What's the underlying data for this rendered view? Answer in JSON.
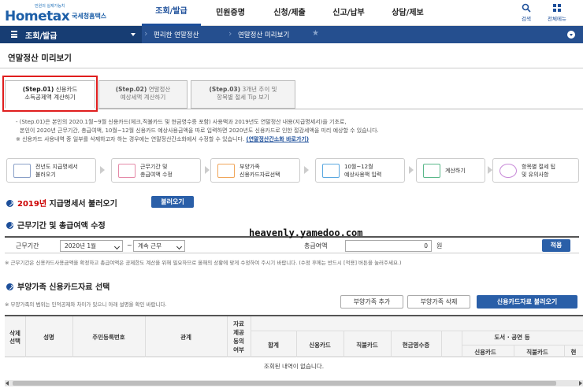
{
  "header": {
    "logo_small": "민원의 실제가능치",
    "logo_main": "Hometax",
    "logo_sub": "국세청홈택스",
    "nav": [
      "조회/발급",
      "민원증명",
      "신청/제출",
      "신고/납부",
      "상담/제보"
    ],
    "search_label": "검색",
    "allmenu_label": "전체메뉴"
  },
  "breadcrumb": {
    "menu_label": "조회/발급",
    "item1": "편리한 연말정산",
    "item2": "연말정산 미리보기"
  },
  "page_title": "연말정산 미리보기",
  "steps": [
    {
      "num": "(Step.01)",
      "line1": "신용카드",
      "line2": "소득공제액 계산하기"
    },
    {
      "num": "(Step.02)",
      "line1": "연말정산",
      "line2": "예상세액 계산하기"
    },
    {
      "num": "(Step.03)",
      "line1": "3개년 추이 및",
      "line2": "항목별 절세 Tip 보기"
    }
  ],
  "notice": {
    "line1": "- (Step.01)은 본인의 2020.1월~9월 신용카드(체크,직불카드 및 현금영수증 포함) 사용액과 2019년도 연말정산 내용(지급명세서)을 기초로,",
    "line2": "본인이 2020년 근무기간, 총급여액, 10월~12월 신용카드 예상사용금액을 따로 입력하면 2020년도 신용카드로 인한 절감세액을 미리 예상할 수 있습니다.",
    "line3": "※ 신용카드 사용내역 중 일부를 삭제하고자 하는 경우에는 연말정산간소화에서 수정할 수 있습니다.",
    "link": "(연말정산간소화 바로가기)"
  },
  "process": [
    {
      "l1": "전년도 지급명세서",
      "l2": "불러오기",
      "color": "#8aa0c8"
    },
    {
      "l1": "근무기간 및",
      "l2": "총급여액 수정",
      "color": "#e58aa8"
    },
    {
      "l1": "부양가족",
      "l2": "신용카드자료선택",
      "color": "#f0a65a"
    },
    {
      "l1": "10월~12월",
      "l2": "예상사용액 입력",
      "color": "#5aa8e0"
    },
    {
      "l1": "계산하기",
      "l2": "",
      "color": "#5ab88a"
    },
    {
      "l1": "항목별 절세 팁",
      "l2": "및 유의사항",
      "color": "#c88ad8"
    }
  ],
  "section1": {
    "year": "2019년",
    "title": "지급명세서 불러오기",
    "button": "불러오기"
  },
  "section2": {
    "title": "근무기간 및 총급여액 수정",
    "label": "근무기간",
    "start": "2020년 1월",
    "tilde": "~",
    "end": "계속 근무",
    "amount_label": "총급여액",
    "amount_value": "0",
    "won": "원",
    "apply": "적용",
    "note": "※ 근무기간은 신용카드사용금액을 확정하고 총급여액은 공제한도 계산을 위해 필요하므로 올해의 상황에 맞게 수정하여 주시기 바랍니다. (수정 후에는 반드시 [적용] 버튼을 눌러주세요.)"
  },
  "section3": {
    "title": "부양가족 신용카드자료 선택",
    "note": "※ 부양가족의 범위는 인적공제와 차이가 있으니 아래 설명을 확인 바랍니다.",
    "btn_add": "부양가족 추가",
    "btn_delete": "부양가족 삭제",
    "btn_load": "신용카드자료 불러오기"
  },
  "table": {
    "h_select": [
      "삭제",
      "선택"
    ],
    "h_name": "성명",
    "h_rrn": "주민등록번호",
    "h_rel": "관계",
    "h_consent": [
      "자료",
      "제공",
      "동의",
      "여부"
    ],
    "h_total": "합계",
    "h_credit": "신용카드",
    "h_debit": "직불카드",
    "h_cash": "현금영수증",
    "h_culture": "도서 · 공연 등",
    "h_culture_credit": "신용카드",
    "h_culture_debit": "직불카드",
    "h_culture_extra": "현",
    "empty": "조회된 내역이 없습니다."
  },
  "watermark": "heavenly.yamedoo.com"
}
